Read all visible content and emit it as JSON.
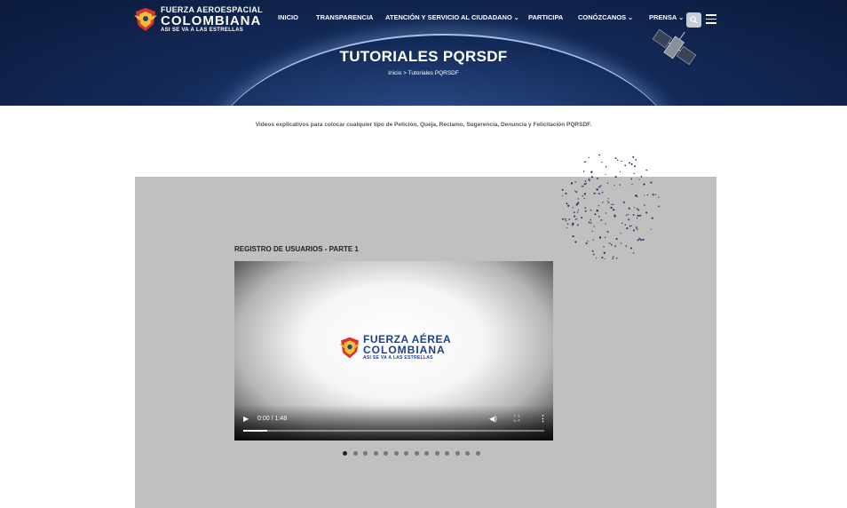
{
  "header": {
    "logo": {
      "line1": "FUERZA AEROESPACIAL",
      "line2": "COLOMBIANA",
      "line3": "ASI SE VA A LAS ESTRELLAS"
    },
    "nav": [
      {
        "label": "INICIO",
        "has_dropdown": false
      },
      {
        "label": "TRANSPARENCIA",
        "has_dropdown": false
      },
      {
        "label": "ATENCIÓN Y SERVICIO AL CIUDADANO",
        "has_dropdown": true
      },
      {
        "label": "PARTICIPA",
        "has_dropdown": false
      },
      {
        "label": "CONÓZCANOS",
        "has_dropdown": true
      },
      {
        "label": "PRENSA",
        "has_dropdown": true
      }
    ],
    "search_icon": "search-icon",
    "menu_icon": "hamburger-icon"
  },
  "hero": {
    "title": "TUTORIALES PQRSDF",
    "breadcrumb": "Inicio  >  Tutoriales PQRSDF"
  },
  "intro": "Videos  explicativos para colocar cualquier tipo de Petición, Queja, Reclamo, Sugerencia, Denuncia y Felicitación PQRSDF.",
  "video": {
    "title": "REGISTRO DE USUARIOS - PARTE 1",
    "logo": {
      "line1": "FUERZA AÉREA",
      "line2": "COLOMBIANA",
      "line3": "ASI SE VA A LAS ESTRELLAS"
    },
    "time": "0:00 / 1:48",
    "progress_fraction": 0.08
  },
  "carousel": {
    "count": 14,
    "active_index": 0
  },
  "colors": {
    "hero_bg": "#132a58",
    "panel_bg": "#c0c0c0",
    "logo_blue": "#1f3f8e"
  }
}
